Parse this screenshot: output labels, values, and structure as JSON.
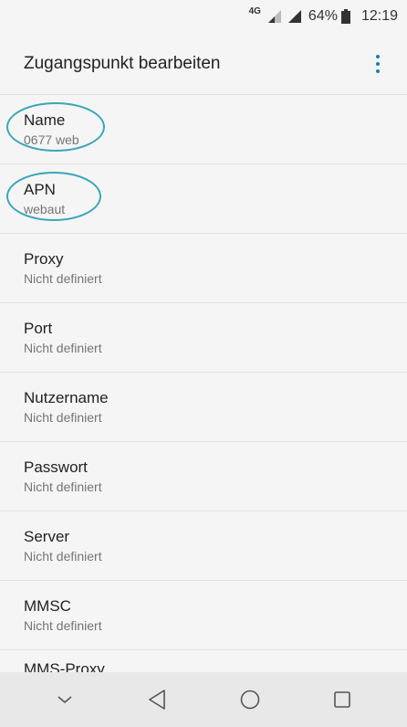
{
  "status_bar": {
    "network_type": "4G",
    "battery_percent": "64%",
    "time": "12:19"
  },
  "app_bar": {
    "title": "Zugangspunkt bearbeiten",
    "menu_icon": "overflow-menu-icon"
  },
  "preferences": [
    {
      "title": "Name",
      "summary": "0677 web",
      "highlighted": true
    },
    {
      "title": "APN",
      "summary": "webaut",
      "highlighted": true
    },
    {
      "title": "Proxy",
      "summary": "Nicht definiert"
    },
    {
      "title": "Port",
      "summary": "Nicht definiert"
    },
    {
      "title": "Nutzername",
      "summary": "Nicht definiert"
    },
    {
      "title": "Passwort",
      "summary": "Nicht definiert"
    },
    {
      "title": "Server",
      "summary": "Nicht definiert"
    },
    {
      "title": "MMSC",
      "summary": "Nicht definiert"
    },
    {
      "title": "MMS-Proxy",
      "summary": ""
    }
  ],
  "nav_bar": {
    "buttons": [
      "chevron-down-icon",
      "back-triangle-icon",
      "home-circle-icon",
      "recents-square-icon"
    ]
  },
  "colors": {
    "accent": "#1a7fa8",
    "annotation": "#3aa6b9",
    "background": "#f5f5f5",
    "nav_background": "#e8e8e8"
  }
}
